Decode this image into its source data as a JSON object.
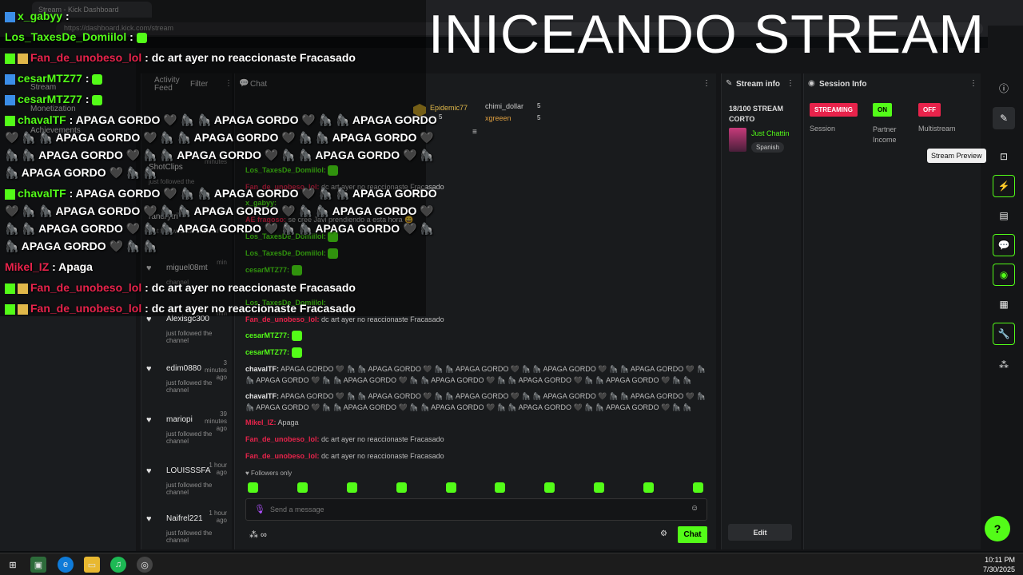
{
  "browser": {
    "tab_title": "Stream - Kick Dashboard",
    "url": "https://dashboard.kick.com/stream"
  },
  "overlay": {
    "title": "INICEANDO STREAM",
    "lines": [
      {
        "name": "x_gabyy",
        "text": "",
        "icon": "kick-badge-icon"
      },
      {
        "name": "Los_TaxesDe_Domiilol",
        "text": "",
        "icon": ""
      },
      {
        "name": "Fan_de_unobeso_lol",
        "text": ": dc art ayer no reaccionaste Fracasado",
        "icon": "crown-icon"
      },
      {
        "name": "cesarMTZ77",
        "text": " :",
        "icon": "kick-badge-icon"
      },
      {
        "name": "cesarMTZ77",
        "text": " :",
        "icon": "kick-badge-icon"
      },
      {
        "name": "chavalTF",
        "text": ": APAGA GORDO 🖤 🦍 🦍 APAGA GORDO 🖤 🦍 🦍 APAGA GORDO",
        "icon": "diamond-icon"
      },
      {
        "name": "",
        "text": "🖤 🦍 🦍 APAGA GORDO 🖤 🦍 🦍 APAGA GORDO 🖤 🦍 🦍 APAGA GORDO 🖤",
        "icon": ""
      },
      {
        "name": "",
        "text": "🦍 🦍 APAGA GORDO 🖤 🦍 🦍 APAGA GORDO 🖤 🦍 🦍 APAGA GORDO 🖤 🦍",
        "icon": ""
      },
      {
        "name": "",
        "text": "🦍 APAGA GORDO 🖤 🦍 🦍",
        "icon": ""
      },
      {
        "name": "chavalTF",
        "text": ": APAGA GORDO 🖤 🦍 🦍 APAGA GORDO 🖤 🦍 🦍 APAGA GORDO",
        "icon": "diamond-icon"
      },
      {
        "name": "",
        "text": "🖤 🦍 🦍 APAGA GORDO 🖤 🦍 🦍 APAGA GORDO 🖤 🦍 🦍 APAGA GORDO 🖤",
        "icon": ""
      },
      {
        "name": "",
        "text": "🦍 🦍 APAGA GORDO 🖤 🦍 🦍 APAGA GORDO 🖤 🦍 🦍 APAGA GORDO 🖤 🦍",
        "icon": ""
      },
      {
        "name": "",
        "text": "🦍 APAGA GORDO 🖤 🦍 🦍",
        "icon": ""
      },
      {
        "name": "Mikel_IZ",
        "text": ": Apaga",
        "icon": ""
      },
      {
        "name": "Fan_de_unobeso_lol",
        "text": ": dc art ayer no reaccionaste Fracasado",
        "icon": "crown-icon"
      },
      {
        "name": "Fan_de_unobeso_lol",
        "text": ": dc art ayer no reaccionaste Fracasado",
        "icon": "crown-icon"
      }
    ]
  },
  "nav": {
    "items": [
      "Stream",
      "Monetization",
      "Achievements"
    ]
  },
  "activity": {
    "title": "Activity Feed",
    "filter": "Filter",
    "items": [
      {
        "user": "ShotClips",
        "time": "minutes",
        "sub": "just followed the"
      },
      {
        "user": "randrytri",
        "time": "minutes",
        "sub": "just followed the channel"
      },
      {
        "user": "miguel08mt",
        "time": "min",
        "sub": "channel"
      },
      {
        "user": "Alexisgc300",
        "time": "min",
        "sub": "just followed the channel"
      },
      {
        "user": "edim0880",
        "time": "3 minutes ago",
        "sub": "just followed the channel"
      },
      {
        "user": "mariopi",
        "time": "39 minutes ago",
        "sub": "just followed the channel"
      },
      {
        "user": "LOUISSSFA",
        "time": "1 hour ago",
        "sub": "just followed the channel"
      },
      {
        "user": "Naifrel221",
        "time": "1 hour ago",
        "sub": "just followed the channel"
      }
    ]
  },
  "chat": {
    "title": "Chat",
    "top_gifters": [
      {
        "name": "Epidemic77",
        "count": "5"
      },
      {
        "name": "chimi_dollar",
        "count": "5"
      },
      {
        "name": "xgreeen",
        "count": "5"
      }
    ],
    "lines": [
      {
        "name": "Los_TaxesDe_Domiilol:",
        "text": "",
        "color": "#53fc18"
      },
      {
        "name": "Fan_de_unobeso_lol:",
        "text": "dc art ayer no reaccionaste Fracasado",
        "color": "#e8234b"
      },
      {
        "name": "x_gabyy:",
        "text": "",
        "color": "#53fc18"
      },
      {
        "name": "AE fragoso:",
        "text": "se cree Javi prendiendo a esta hora 😀",
        "color": "#e8234b"
      },
      {
        "name": "Los_TaxesDe_Domiilol:",
        "text": "",
        "color": "#53fc18"
      },
      {
        "name": "Los_TaxesDe_Domiilol:",
        "text": "",
        "color": "#53fc18"
      },
      {
        "name": "cesarMTZ77:",
        "text": "",
        "color": "#53fc18"
      },
      {
        "name": "Los_TaxesDe_Domiilol:",
        "text": "",
        "color": "#53fc18"
      },
      {
        "name": "Fan_de_unobeso_lol:",
        "text": "dc art ayer no reaccionaste Fracasado",
        "color": "#e8234b"
      },
      {
        "name": "cesarMTZ77:",
        "text": "",
        "color": "#53fc18"
      },
      {
        "name": "cesarMTZ77:",
        "text": "",
        "color": "#53fc18"
      },
      {
        "name": "chavalTF:",
        "text": "APAGA GORDO 🖤 🦍 🦍 APAGA GORDO 🖤 🦍 🦍 APAGA GORDO 🖤 🦍 🦍 APAGA GORDO 🖤 🦍 🦍 APAGA GORDO 🖤 🦍 🦍 APAGA GORDO 🖤 🦍 🦍 APAGA GORDO 🖤 🦍 🦍 APAGA GORDO 🖤 🦍 🦍 APAGA GORDO 🖤 🦍 🦍 APAGA GORDO 🖤 🦍 🦍",
        "color": "#e6e6e6"
      },
      {
        "name": "chavalTF:",
        "text": "APAGA GORDO 🖤 🦍 🦍 APAGA GORDO 🖤 🦍 🦍 APAGA GORDO 🖤 🦍 🦍 APAGA GORDO 🖤 🦍 🦍 APAGA GORDO 🖤 🦍 🦍 APAGA GORDO 🖤 🦍 🦍 APAGA GORDO 🖤 🦍 🦍 APAGA GORDO 🖤 🦍 🦍 APAGA GORDO 🖤 🦍 🦍 APAGA GORDO 🖤 🦍 🦍",
        "color": "#e6e6e6"
      },
      {
        "name": "Mikel_IZ:",
        "text": "Apaga",
        "color": "#e8234b"
      },
      {
        "name": "Fan_de_unobeso_lol:",
        "text": "dc art ayer no reaccionaste Fracasado",
        "color": "#e8234b"
      },
      {
        "name": "Fan_de_unobeso_lol:",
        "text": "dc art ayer no reaccionaste Fracasado",
        "color": "#e8234b"
      }
    ],
    "followers_only": "Followers only",
    "placeholder": "Send a message",
    "send_label": "Chat"
  },
  "stream_info": {
    "title": "Stream info",
    "stream_title": "18/100 STREAM CORTO",
    "category": "Just Chattin",
    "language": "Spanish",
    "edit_label": "Edit"
  },
  "session_info": {
    "title": "Session Info",
    "items": [
      {
        "badge": "STREAMING",
        "label": "Session",
        "color": "#e8234b"
      },
      {
        "badge": "ON",
        "label": "Partner Income",
        "color": "#53fc18"
      },
      {
        "badge": "OFF",
        "label": "Multistream",
        "color": "#e8234b"
      }
    ]
  },
  "rail": {
    "tooltip": "Stream Preview"
  },
  "taskbar": {
    "time": "10:11 PM",
    "date": "7/30/2025"
  }
}
